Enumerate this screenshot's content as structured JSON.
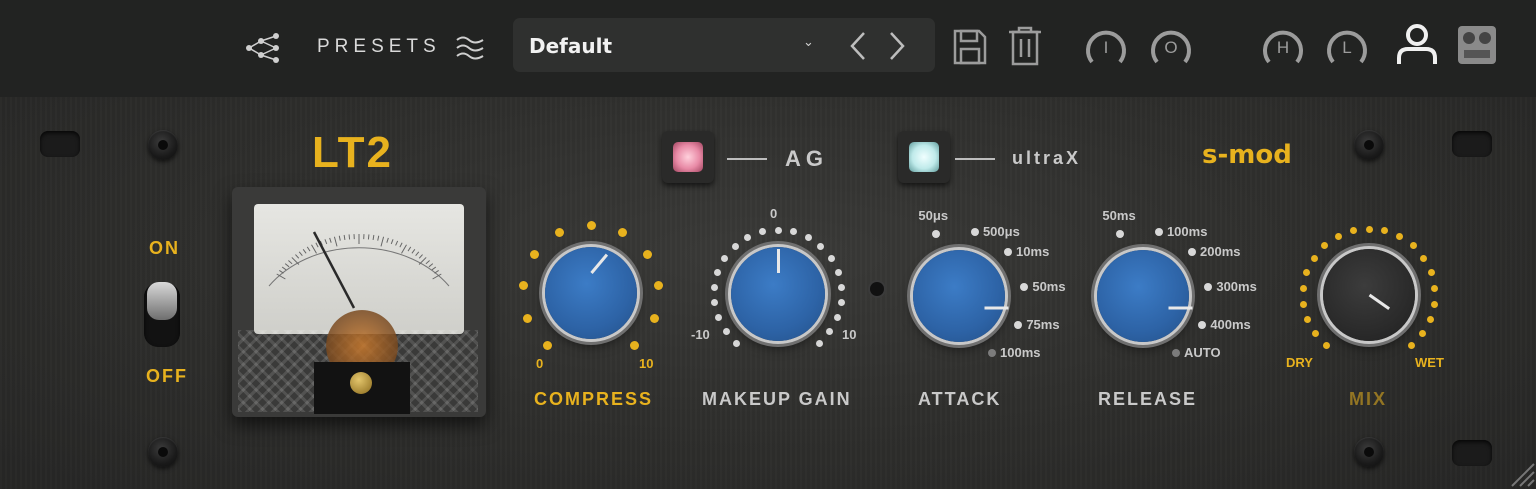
{
  "toolbar": {
    "presets_label": "PRESETS",
    "preset_name": "Default",
    "icons": [
      "share-icon",
      "waves-icon",
      "dropdown-caret-icon",
      "prev-icon",
      "next-icon",
      "save-icon",
      "trash-icon",
      "meter-i-icon",
      "meter-o-icon",
      "meter-h-icon",
      "meter-l-icon",
      "user-icon",
      "tape-icon"
    ],
    "meter_i": "I",
    "meter_o": "O",
    "meter_h": "H",
    "meter_l": "L"
  },
  "panel": {
    "title": "LT2",
    "brand": "s-mod",
    "switch": {
      "on": "ON",
      "off": "OFF"
    },
    "ag_label": "AG",
    "ultrax_label": "ultraX",
    "compress": {
      "label": "COMPRESS",
      "min": "0",
      "max": "10"
    },
    "makeup": {
      "label": "MAKEUP GAIN",
      "min": "-10",
      "mid": "0",
      "max": "10"
    },
    "attack": {
      "label": "ATTACK",
      "steps": [
        "50μs",
        "500μs",
        "10ms",
        "50ms",
        "75ms",
        "100ms"
      ]
    },
    "release": {
      "label": "RELEASE",
      "steps": [
        "50ms",
        "100ms",
        "200ms",
        "300ms",
        "400ms",
        "AUTO"
      ]
    },
    "mix": {
      "label": "MIX",
      "dry": "DRY",
      "wet": "WET"
    }
  },
  "colors": {
    "gold": "#e8b21e",
    "knob_blue": "#2d63a6",
    "led_pink": "#e88aa6",
    "led_cyan": "#bfeaea"
  }
}
